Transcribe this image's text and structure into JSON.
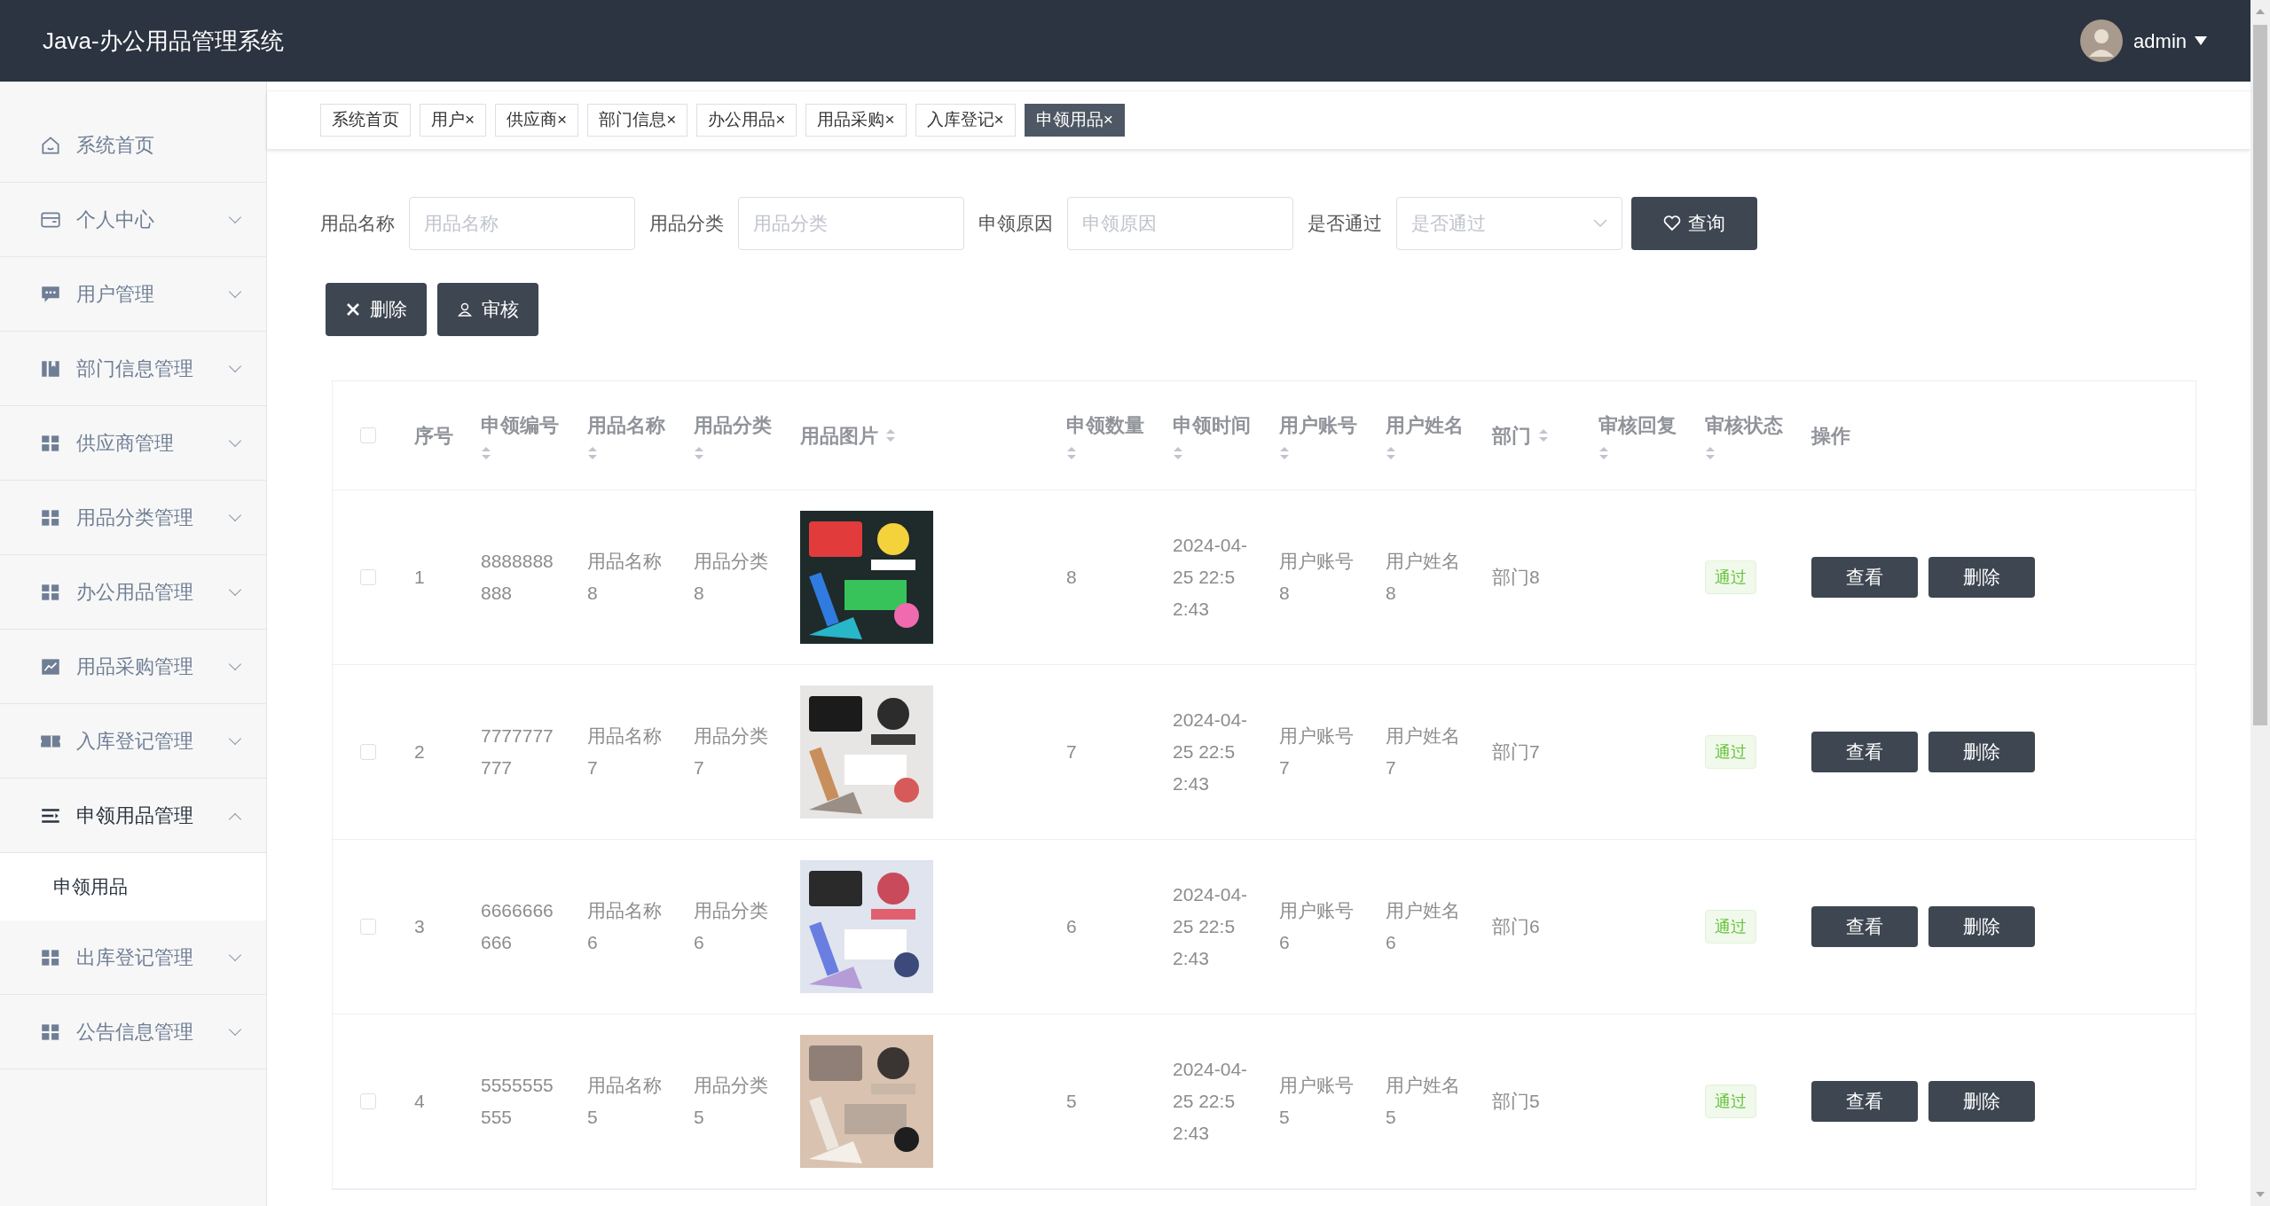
{
  "header": {
    "title": "Java-办公用品管理系统",
    "user": "admin"
  },
  "sidebar": {
    "items": [
      {
        "label": "系统首页"
      },
      {
        "label": "个人中心",
        "expanded": false
      },
      {
        "label": "用户管理",
        "expanded": false
      },
      {
        "label": "部门信息管理",
        "expanded": false
      },
      {
        "label": "供应商管理",
        "expanded": false
      },
      {
        "label": "用品分类管理",
        "expanded": false
      },
      {
        "label": "办公用品管理",
        "expanded": false
      },
      {
        "label": "用品采购管理",
        "expanded": false
      },
      {
        "label": "入库登记管理",
        "expanded": false
      },
      {
        "label": "申领用品管理",
        "expanded": true,
        "children": [
          {
            "label": "申领用品",
            "selected": true
          }
        ]
      },
      {
        "label": "出库登记管理",
        "expanded": false
      },
      {
        "label": "公告信息管理",
        "expanded": false
      }
    ]
  },
  "tabs": [
    {
      "label": "系统首页",
      "selected": false
    },
    {
      "label": "用户",
      "close": "×",
      "selected": false
    },
    {
      "label": "供应商",
      "close": "×",
      "selected": false
    },
    {
      "label": "部门信息",
      "close": "×",
      "selected": false
    },
    {
      "label": "办公用品",
      "close": "×",
      "selected": false
    },
    {
      "label": "用品采购",
      "close": "×",
      "selected": false
    },
    {
      "label": "入库登记",
      "close": "×",
      "selected": false
    },
    {
      "label": "申领用品",
      "close": "×",
      "selected": true
    }
  ],
  "filters": [
    {
      "kind": "input",
      "label": "用品名称",
      "placeholder": "用品名称"
    },
    {
      "kind": "input",
      "label": "用品分类",
      "placeholder": "用品分类"
    },
    {
      "kind": "input",
      "label": "申领原因",
      "placeholder": "申领原因"
    },
    {
      "kind": "select",
      "label": "是否通过",
      "placeholder": "是否通过"
    }
  ],
  "search_button": "查询",
  "actions": [
    "删除",
    "审核"
  ],
  "table": {
    "select_all_checked": false,
    "columns": [
      {
        "label": "序号",
        "sortable": false
      },
      {
        "label": "申领编号",
        "sortable": true
      },
      {
        "label": "用品名称",
        "sortable": true
      },
      {
        "label": "用品分类",
        "sortable": true
      },
      {
        "label": "用品图片",
        "sortable": true
      },
      {
        "label": "申领数量",
        "sortable": true
      },
      {
        "label": "申领时间",
        "sortable": true
      },
      {
        "label": "用户账号",
        "sortable": true
      },
      {
        "label": "用户姓名",
        "sortable": true
      },
      {
        "label": "部门",
        "sortable": true
      },
      {
        "label": "审核回复",
        "sortable": true
      },
      {
        "label": "审核状态",
        "sortable": true
      },
      {
        "label": "操作",
        "sortable": false
      }
    ],
    "rows": [
      {
        "checked": false,
        "index": "1",
        "code": "8888888888",
        "name": "用品名称8",
        "category": "用品分类8",
        "quantity": "8",
        "time": "2024-04-25 22:52:43",
        "account": "用户账号8",
        "username": "用户姓名8",
        "department": "部门8",
        "status": "通过",
        "buttons": [
          "查看",
          "删除"
        ]
      },
      {
        "checked": false,
        "index": "2",
        "code": "7777777777",
        "name": "用品名称7",
        "category": "用品分类7",
        "quantity": "7",
        "time": "2024-04-25 22:52:43",
        "account": "用户账号7",
        "username": "用户姓名7",
        "department": "部门7",
        "status": "通过",
        "buttons": [
          "查看",
          "删除"
        ]
      },
      {
        "checked": false,
        "index": "3",
        "code": "6666666666",
        "name": "用品名称6",
        "category": "用品分类6",
        "quantity": "6",
        "time": "2024-04-25 22:52:43",
        "account": "用户账号6",
        "username": "用户姓名6",
        "department": "部门6",
        "status": "通过",
        "buttons": [
          "查看",
          "删除"
        ]
      },
      {
        "checked": false,
        "index": "4",
        "code": "5555555555",
        "name": "用品名称5",
        "category": "用品分类5",
        "quantity": "5",
        "time": "2024-04-25 22:52:43",
        "account": "用户账号5",
        "username": "用户姓名5",
        "department": "部门5",
        "status": "通过",
        "buttons": [
          "查看",
          "删除"
        ]
      }
    ]
  }
}
